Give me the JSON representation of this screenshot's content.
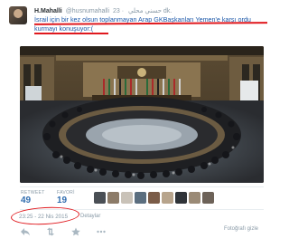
{
  "tweet": {
    "fullname": "H.Mahalli",
    "screen_name": "@husnumahalli",
    "arabic_name": "حسني محلي",
    "time_ago": "· 23 dk.",
    "text_line1": "İsrail için bir kez olsun toplanmayan Arap GKBaşkanları Yemen'e karşı ordu",
    "text_line2": "kurmayı konuşuyor:(",
    "retweet_label": "RETWEET",
    "retweet_count": "49",
    "favorite_label": "FAVORİ",
    "favorite_count": "19",
    "timestamp": "23:25 - 22 Nis 2015",
    "details_label": "Detaylar",
    "hide_photo_label": "Fotoğrafı gizle"
  },
  "colors": {
    "link": "#1b57a8",
    "annotation": "#e0191e",
    "count": "#2f6cae"
  },
  "icons": [
    "reply-icon",
    "retweet-icon",
    "favorite-icon",
    "more-icon"
  ]
}
